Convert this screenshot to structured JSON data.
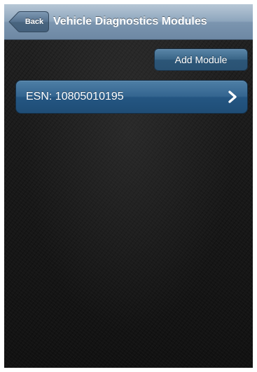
{
  "navbar": {
    "back_label": "Back",
    "title": "Vehicle Diagnostics Modules"
  },
  "toolbar": {
    "add_module_label": "Add Module"
  },
  "modules": [
    {
      "label": "ESN: 10805010195",
      "icon": "chevron-right-icon"
    }
  ],
  "colors": {
    "navbar": "#8ea6bd",
    "button_blue": "#346590",
    "background": "#1b1b1b"
  }
}
